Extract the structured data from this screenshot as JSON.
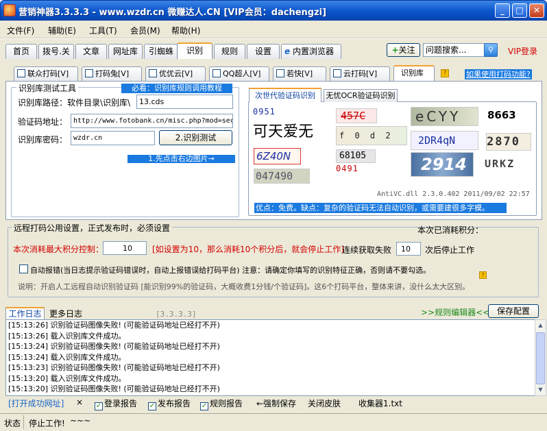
{
  "window": {
    "title": "营销神器3.3.3.3 - www.wzdr.cn 微赚达人.CN [VIP会员：dachengzi]",
    "min": "_",
    "max": "□",
    "close": "✕"
  },
  "menu": [
    "文件(F)",
    "辅助(E)",
    "工具(T)",
    "会员(M)",
    "帮助(H)"
  ],
  "nav": {
    "tabs": [
      "首页",
      "拨号.关",
      "文章",
      "网址库",
      "引蜘蛛",
      "识别",
      "规则",
      "设置"
    ],
    "browser_tab": "内置浏览器",
    "follow": "关注",
    "search_placeholder": "问题搜索...",
    "vip_login": "VIP登录"
  },
  "subtabs": [
    "联众打码[V]",
    "打码兔[V]",
    "优优云[V]",
    "QQ超人[V]",
    "若快[V]",
    "云打码[V]",
    "识别库"
  ],
  "help_link": "如果使用打码功能?",
  "tester": {
    "legend": "识别库测试工具",
    "must_read": "必看：识别库规则调用教程",
    "path_label": "识别库路径：软件目录\\识别库\\",
    "path_value": "13.cds",
    "url_label": "验证码地址：",
    "url_value": "http://www.fotobank.cn/misc.php?mod=seccode",
    "pwd_label": "识别库密码：",
    "pwd_value": "wzdr.cn",
    "test_button": "2.识别测试",
    "hint": "1.先点击右边图片→"
  },
  "captcha_panel": {
    "tab_active": "次世代验证码识别",
    "tab_other": "无忧OCR验证码识别",
    "samples": [
      "0951",
      "可天爱无",
      "6Z40N",
      "047490",
      "457C",
      "f 0 d 2",
      "68105",
      "0491",
      "eCYY",
      "2DR4qN",
      "2914",
      "8663",
      "2870",
      "URKZ"
    ],
    "version": "AntiVC.dll 2.3.0.402 2011/09/02 22:57",
    "pros": "优点：免费。缺点：复杂的验证码无法自动识别，或需要建很多字模。"
  },
  "remote": {
    "legend": "远程打码公用设置，正式发布时，必须设置",
    "consumed_label": "本次已消耗积分：",
    "max_label": "本次消耗最大积分控制：",
    "max_value": "10",
    "max_note": "[如设置为10，那么消耗10个积分后，就会停止工作]",
    "fail_label": "连续获取失败",
    "fail_value": "10",
    "fail_suffix": "次后停止工作",
    "auto_report": "自动报错(当日志提示验证码错误时，自动上报错误给打码平台) 注意：请确定你填写的识别特征正确，否则请不要勾选。",
    "desc": "说明：开启人工远程自动识别验证码 [能识别99%的验证码，大概收费1分钱/个验证码]。这6个打码平台，整体来讲，没什么太大区别。"
  },
  "log": {
    "tab_work": "工作日志",
    "tab_more": "更多日志",
    "version": "[3.3.3.3]",
    "rule_editor": ">>规则编辑器<<",
    "save_button": "保存配置",
    "lines": [
      "[15:13:26] 识别验证码图像失败! (可能验证码地址已经打不开)",
      "[15:13:26] 载入识别库文件成功。",
      "[15:13:24] 识别验证码图像失败! (可能验证码地址已经打不开)",
      "[15:13:24] 载入识别库文件成功。",
      "[15:13:23] 识别验证码图像失败! (可能验证码地址已经打不开)",
      "[15:13:20] 载入识别库文件成功。",
      "[15:13:20] 识别验证码图像失败! (可能验证码地址已经打不开)"
    ]
  },
  "bottom": {
    "open_url": "[打开成功网址]",
    "x": "×",
    "login_report": "登录报告",
    "publish_report": "发布报告",
    "rule_report": "规则报告",
    "force_save": "←强制保存",
    "close_skin": "关闭皮肤",
    "collector": "收集器1.txt"
  },
  "status": {
    "label": "状态",
    "text": "停止工作!",
    "extra": "~~~"
  }
}
